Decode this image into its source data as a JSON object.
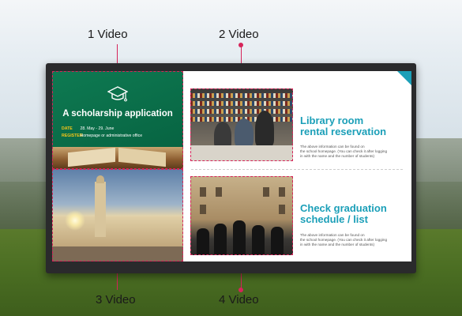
{
  "captions": {
    "video1": "1 Video",
    "video2": "2 Video",
    "video3": "3 Video",
    "video4": "4 Video"
  },
  "scholarship": {
    "title": "A scholarship application",
    "date_label": "DATE",
    "date_value": "28. May - 29. June",
    "register_label": "REGISTER",
    "register_value": "Homepage or administrative office"
  },
  "library": {
    "heading_line1": "Library room",
    "heading_line2": "rental reservation",
    "desc_line1": "The above information can be found on",
    "desc_line2": "the school homepage. (You can check it after logging",
    "desc_line3": "in with the name and the number of students)"
  },
  "graduation": {
    "heading_line1": "Check graduation",
    "heading_line2": "schedule / list",
    "desc_line1": "The above information can be found on",
    "desc_line2": "the school homepage. (You can check it after logging",
    "desc_line3": "in with the name and the number of students)"
  },
  "colors": {
    "accent": "#1b9fb8",
    "green_panel": "#0e7a52",
    "highlight": "#d6245a",
    "yellow_label": "#f5c518"
  },
  "icons": {
    "graduation_cap": "graduation-cap-icon"
  }
}
